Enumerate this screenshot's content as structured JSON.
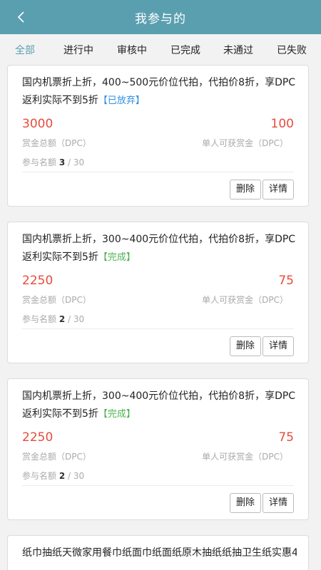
{
  "header": {
    "title": "我参与的",
    "back_icon": "chevron-left-icon"
  },
  "tabs": [
    {
      "label": "全部",
      "active": true
    },
    {
      "label": "进行中"
    },
    {
      "label": "审核中"
    },
    {
      "label": "已完成"
    },
    {
      "label": "未通过"
    },
    {
      "label": "已失败"
    }
  ],
  "cards": [
    {
      "title": "国内机票折上折，400~500元价位代拍，代拍价8折，享DPC返利实际不到5折",
      "status": "【已放弃】",
      "total_reward": "3000",
      "total_label": "赏金总额（DPC）",
      "per_reward": "100",
      "per_label": "单人可获赏金（DPC）",
      "quota_label": "参与名额",
      "quota_count": "3",
      "quota_total": "/ 30",
      "delete_label": "删除",
      "detail_label": "详情"
    },
    {
      "title": "国内机票折上折，300~400元价位代拍，代拍价8折，享DPC返利实际不到5折",
      "status": "【完成】",
      "total_reward": "2250",
      "total_label": "赏金总额（DPC）",
      "per_reward": "75",
      "per_label": "单人可获赏金（DPC）",
      "quota_label": "参与名额",
      "quota_count": "2",
      "quota_total": "/ 30",
      "delete_label": "删除",
      "detail_label": "详情"
    },
    {
      "title": "国内机票折上折，300~400元价位代拍，代拍价8折，享DPC返利实际不到5折",
      "status": "【完成】",
      "total_reward": "2250",
      "total_label": "赏金总额（DPC）",
      "per_reward": "75",
      "per_label": "单人可获赏金（DPC）",
      "quota_label": "参与名额",
      "quota_count": "2",
      "quota_total": "/ 30",
      "delete_label": "删除",
      "detail_label": "详情"
    },
    {
      "title": "纸巾抽纸天微家用餐巾纸面巾纸面纸原木抽纸纸抽卫生纸实惠4"
    }
  ],
  "colors": {
    "header_bg": "#5a9fb0",
    "accent": "#5a9fb0",
    "reward": "#e74c3c",
    "status_abandoned": "#2f8fe0",
    "status_done": "#4cb34f"
  }
}
